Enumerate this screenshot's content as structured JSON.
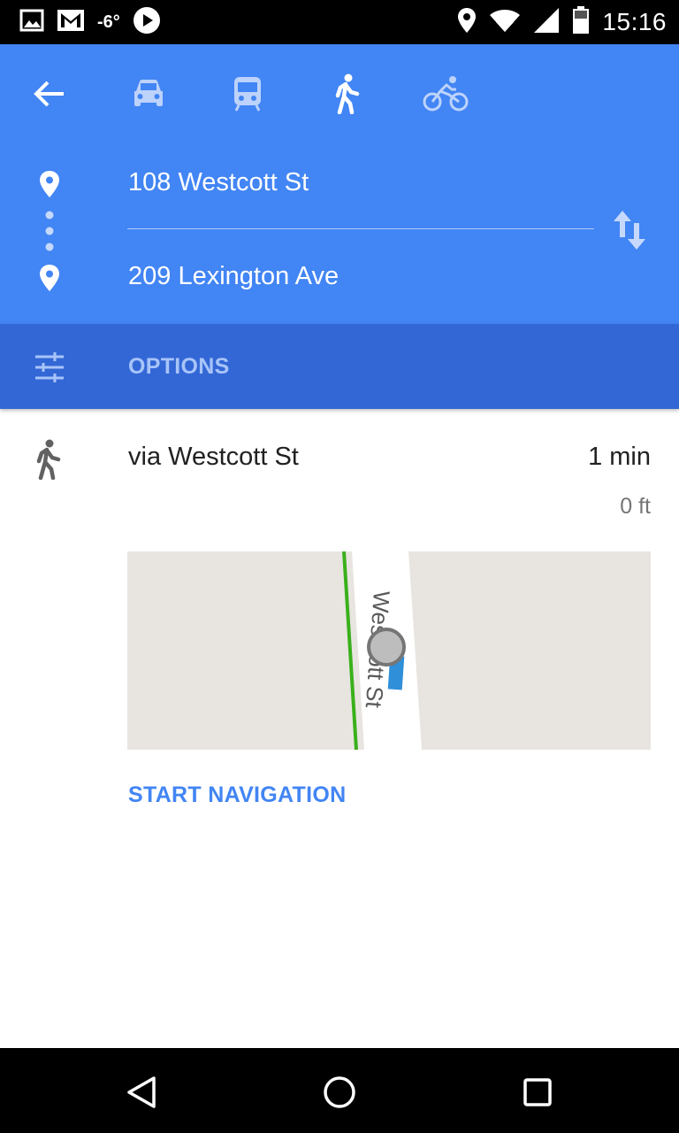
{
  "status_bar": {
    "temperature": "-6°",
    "time": "15:16",
    "icons": [
      "image-icon",
      "gmail-icon",
      "play-icon",
      "location-icon",
      "wifi-icon",
      "signal-icon",
      "battery-icon"
    ]
  },
  "header": {
    "modes": [
      "car-icon",
      "transit-icon",
      "walk-icon",
      "bike-icon"
    ],
    "selected_mode": "walk-icon",
    "origin": "108 Westcott St",
    "destination": "209 Lexington Ave"
  },
  "options": {
    "label": "OPTIONS"
  },
  "route": {
    "title": "via Westcott St",
    "duration": "1 min",
    "distance": "0 ft",
    "map_street_label": "Westcott St"
  },
  "actions": {
    "start_navigation": "START NAVIGATION"
  },
  "colors": {
    "header_blue": "#4285f4",
    "options_blue": "#3367d6",
    "accent_blue": "#4285f4",
    "route_green": "#3ab01c"
  }
}
